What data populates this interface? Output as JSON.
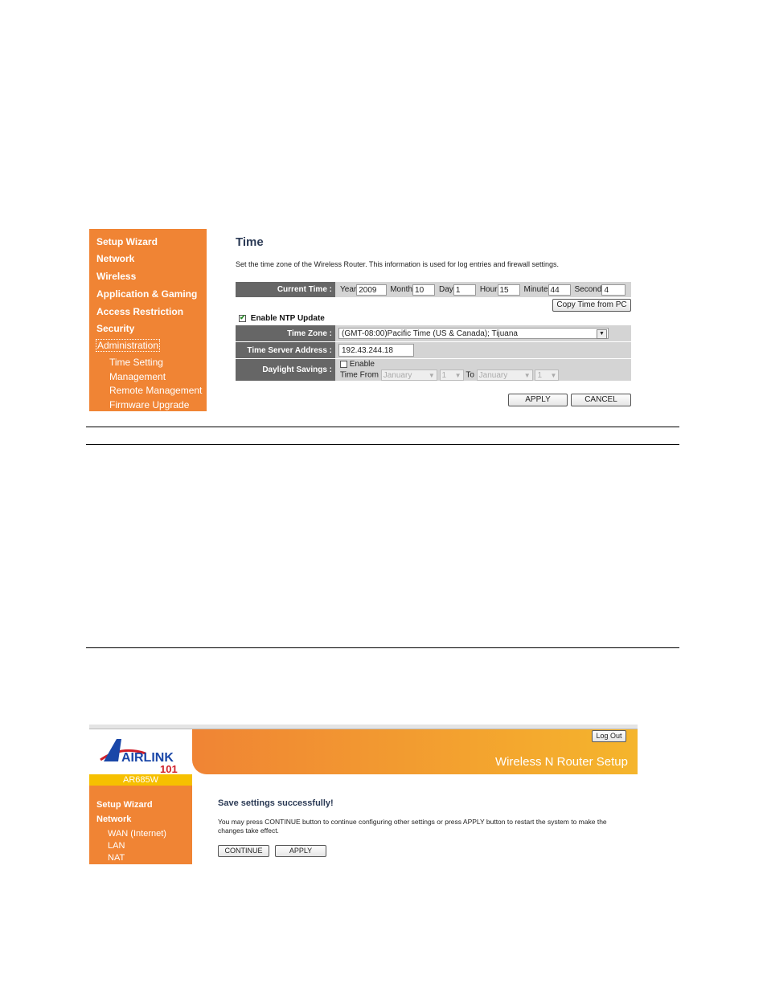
{
  "screenshot1": {
    "sidebar": {
      "items": [
        {
          "label": "Setup Wizard"
        },
        {
          "label": "Network"
        },
        {
          "label": "Wireless"
        },
        {
          "label": "Application & Gaming"
        },
        {
          "label": "Access Restriction"
        },
        {
          "label": "Security"
        },
        {
          "label": "Administration",
          "focused": true
        }
      ],
      "subitems": [
        {
          "label": "Time Setting"
        },
        {
          "label": "Management"
        },
        {
          "label": "Remote Management"
        },
        {
          "label": "Firmware Upgrade"
        }
      ]
    },
    "main": {
      "title": "Time",
      "description": "Set the time zone of the Wireless Router. This information is used for log entries and firewall settings.",
      "current_time": {
        "label": "Current Time :",
        "year_label": "Year",
        "year": "2009",
        "month_label": "Month",
        "month": "10",
        "day_label": "Day",
        "day": "1",
        "hour_label": "Hour",
        "hour": "15",
        "minute_label": "Minute",
        "minute": "44",
        "second_label": "Second",
        "second": "4"
      },
      "copy_time_button": "Copy Time from PC",
      "ntp": {
        "label": "Enable NTP Update",
        "checked": true
      },
      "time_zone": {
        "label": "Time Zone :",
        "value": "(GMT-08:00)Pacific Time (US & Canada); Tijuana"
      },
      "time_server": {
        "label": "Time Server Address :",
        "value": "192.43.244.18"
      },
      "daylight": {
        "label": "Daylight Savings :",
        "enable_label": "Enable",
        "enabled": false,
        "from_label": "Time From",
        "from_month": "January",
        "from_day": "1",
        "to_label": "To",
        "to_month": "January",
        "to_day": "1"
      },
      "apply_button": "APPLY",
      "cancel_button": "CANCEL"
    }
  },
  "screenshot2": {
    "brand": {
      "logo_text": "AIRLINK",
      "logo_number": "101",
      "model": "AR685W"
    },
    "header": {
      "title": "Wireless N Router Setup",
      "logout_button": "Log Out"
    },
    "sidebar": {
      "items": [
        {
          "label": "Setup Wizard"
        },
        {
          "label": "Network"
        }
      ],
      "subitems": [
        {
          "label": "WAN (Internet)"
        },
        {
          "label": "LAN"
        },
        {
          "label": "NAT"
        }
      ]
    },
    "main": {
      "heading": "Save settings successfully!",
      "message": "You may press CONTINUE button to continue configuring other settings or press APPLY button to restart the system to make the changes take effect.",
      "continue_button": "CONTINUE",
      "apply_button": "APPLY"
    }
  },
  "colors": {
    "sidebar_orange": "#f08434",
    "label_gray": "#666666",
    "model_yellow": "#f6c000"
  }
}
